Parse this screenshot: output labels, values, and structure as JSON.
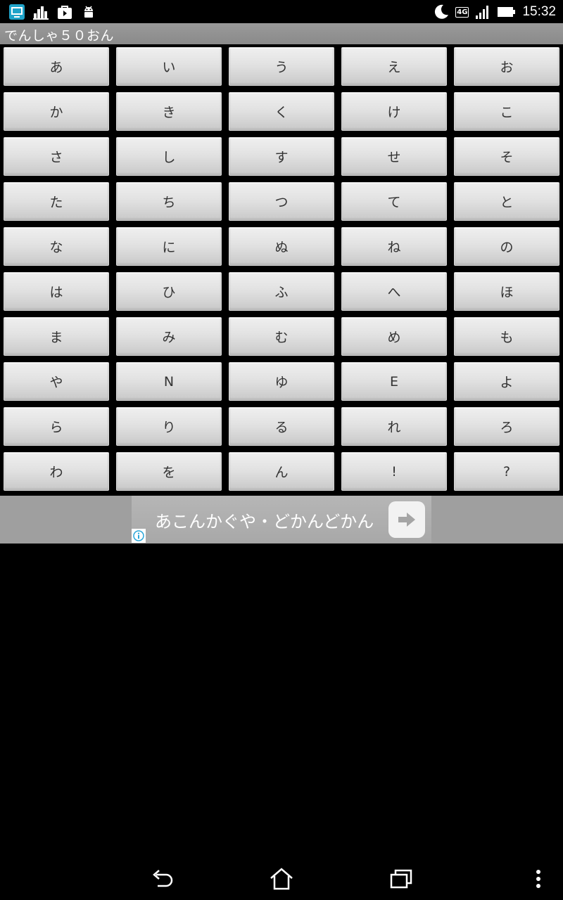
{
  "status_bar": {
    "left_icons": [
      "screen-app-icon",
      "chart-app-icon",
      "store-bag-icon",
      "android-debug-icon"
    ],
    "right_icons": [
      "moon-icon",
      "network-4g-icon",
      "signal-icon",
      "battery-icon"
    ],
    "network_label": "4G",
    "time": "15:32"
  },
  "app": {
    "title": "でんしゃ５０おん"
  },
  "keys": [
    [
      "あ",
      "い",
      "う",
      "え",
      "お"
    ],
    [
      "か",
      "き",
      "く",
      "け",
      "こ"
    ],
    [
      "さ",
      "し",
      "す",
      "せ",
      "そ"
    ],
    [
      "た",
      "ち",
      "つ",
      "て",
      "と"
    ],
    [
      "な",
      "に",
      "ぬ",
      "ね",
      "の"
    ],
    [
      "は",
      "ひ",
      "ふ",
      "へ",
      "ほ"
    ],
    [
      "ま",
      "み",
      "む",
      "め",
      "も"
    ],
    [
      "や",
      "N",
      "ゆ",
      "E",
      "よ"
    ],
    [
      "ら",
      "り",
      "る",
      "れ",
      "ろ"
    ],
    [
      "わ",
      "を",
      "ん",
      "!",
      "?"
    ]
  ],
  "ad": {
    "text": "あこんかぐや・どかんどかん",
    "cta_icon": "arrow-right-icon",
    "info_icon": "info-icon"
  },
  "nav_bar": {
    "buttons": [
      "back-icon",
      "home-icon",
      "recent-apps-icon",
      "overflow-menu-icon"
    ]
  },
  "colors": {
    "title_bar": "#9a9a9a",
    "key_face": "#e2e2e2",
    "ad_bar": "#9f9f9f",
    "background": "#000000"
  }
}
